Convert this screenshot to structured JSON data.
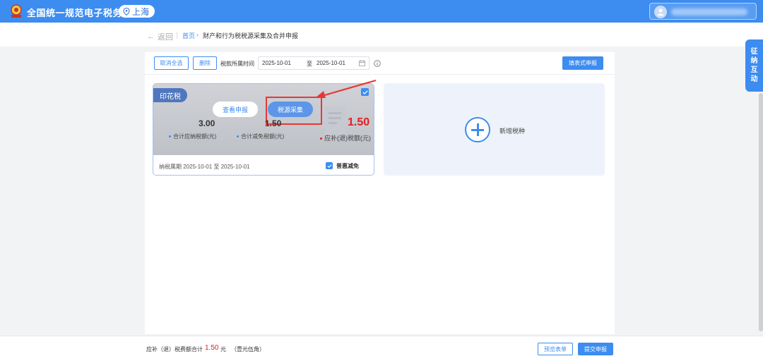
{
  "header": {
    "title": "全国统一规范电子税务局",
    "region": "上海",
    "logo_icon": "tax-bureau-emblem"
  },
  "breadcrumb": {
    "back": "返回",
    "home": "首页",
    "separator": "›",
    "current": "财产和行为税税源采集及合并申报"
  },
  "toolbar": {
    "deselect_all": "取消全选",
    "delete": "删除",
    "period_label": "税款所属时间",
    "start_date": "2025-10-01",
    "range_sep": "至",
    "end_date": "2025-10-01",
    "fill_form": "填表式申报"
  },
  "tax_card": {
    "tag": "印花税",
    "view_button": "查看申报",
    "collect_button": "税源采集",
    "total_payable": "3.00",
    "total_payable_label": "合计应纳税额(元)",
    "total_relief": "1.50",
    "total_relief_label": "合计减免税额(元)",
    "due_amount": "1.50",
    "due_label": "应补(退)税额(元)",
    "period": "纳税属期 2025-10-01 至 2025-10-01",
    "discount": "普惠减免",
    "checked": true
  },
  "new_card": {
    "label": "新增税种"
  },
  "side_tab": {
    "chars": [
      "征",
      "纳",
      "互",
      "动"
    ]
  },
  "footer": {
    "total_label": "应补（退）税费额合计",
    "total_amount": "1.50",
    "unit": "元",
    "amount_words": "（壹元伍角）",
    "preview": "预览表单",
    "submit": "提交申报"
  },
  "colors": {
    "primary": "#3d8cf0",
    "highlight": "#e53935",
    "amount": "#e02020"
  }
}
